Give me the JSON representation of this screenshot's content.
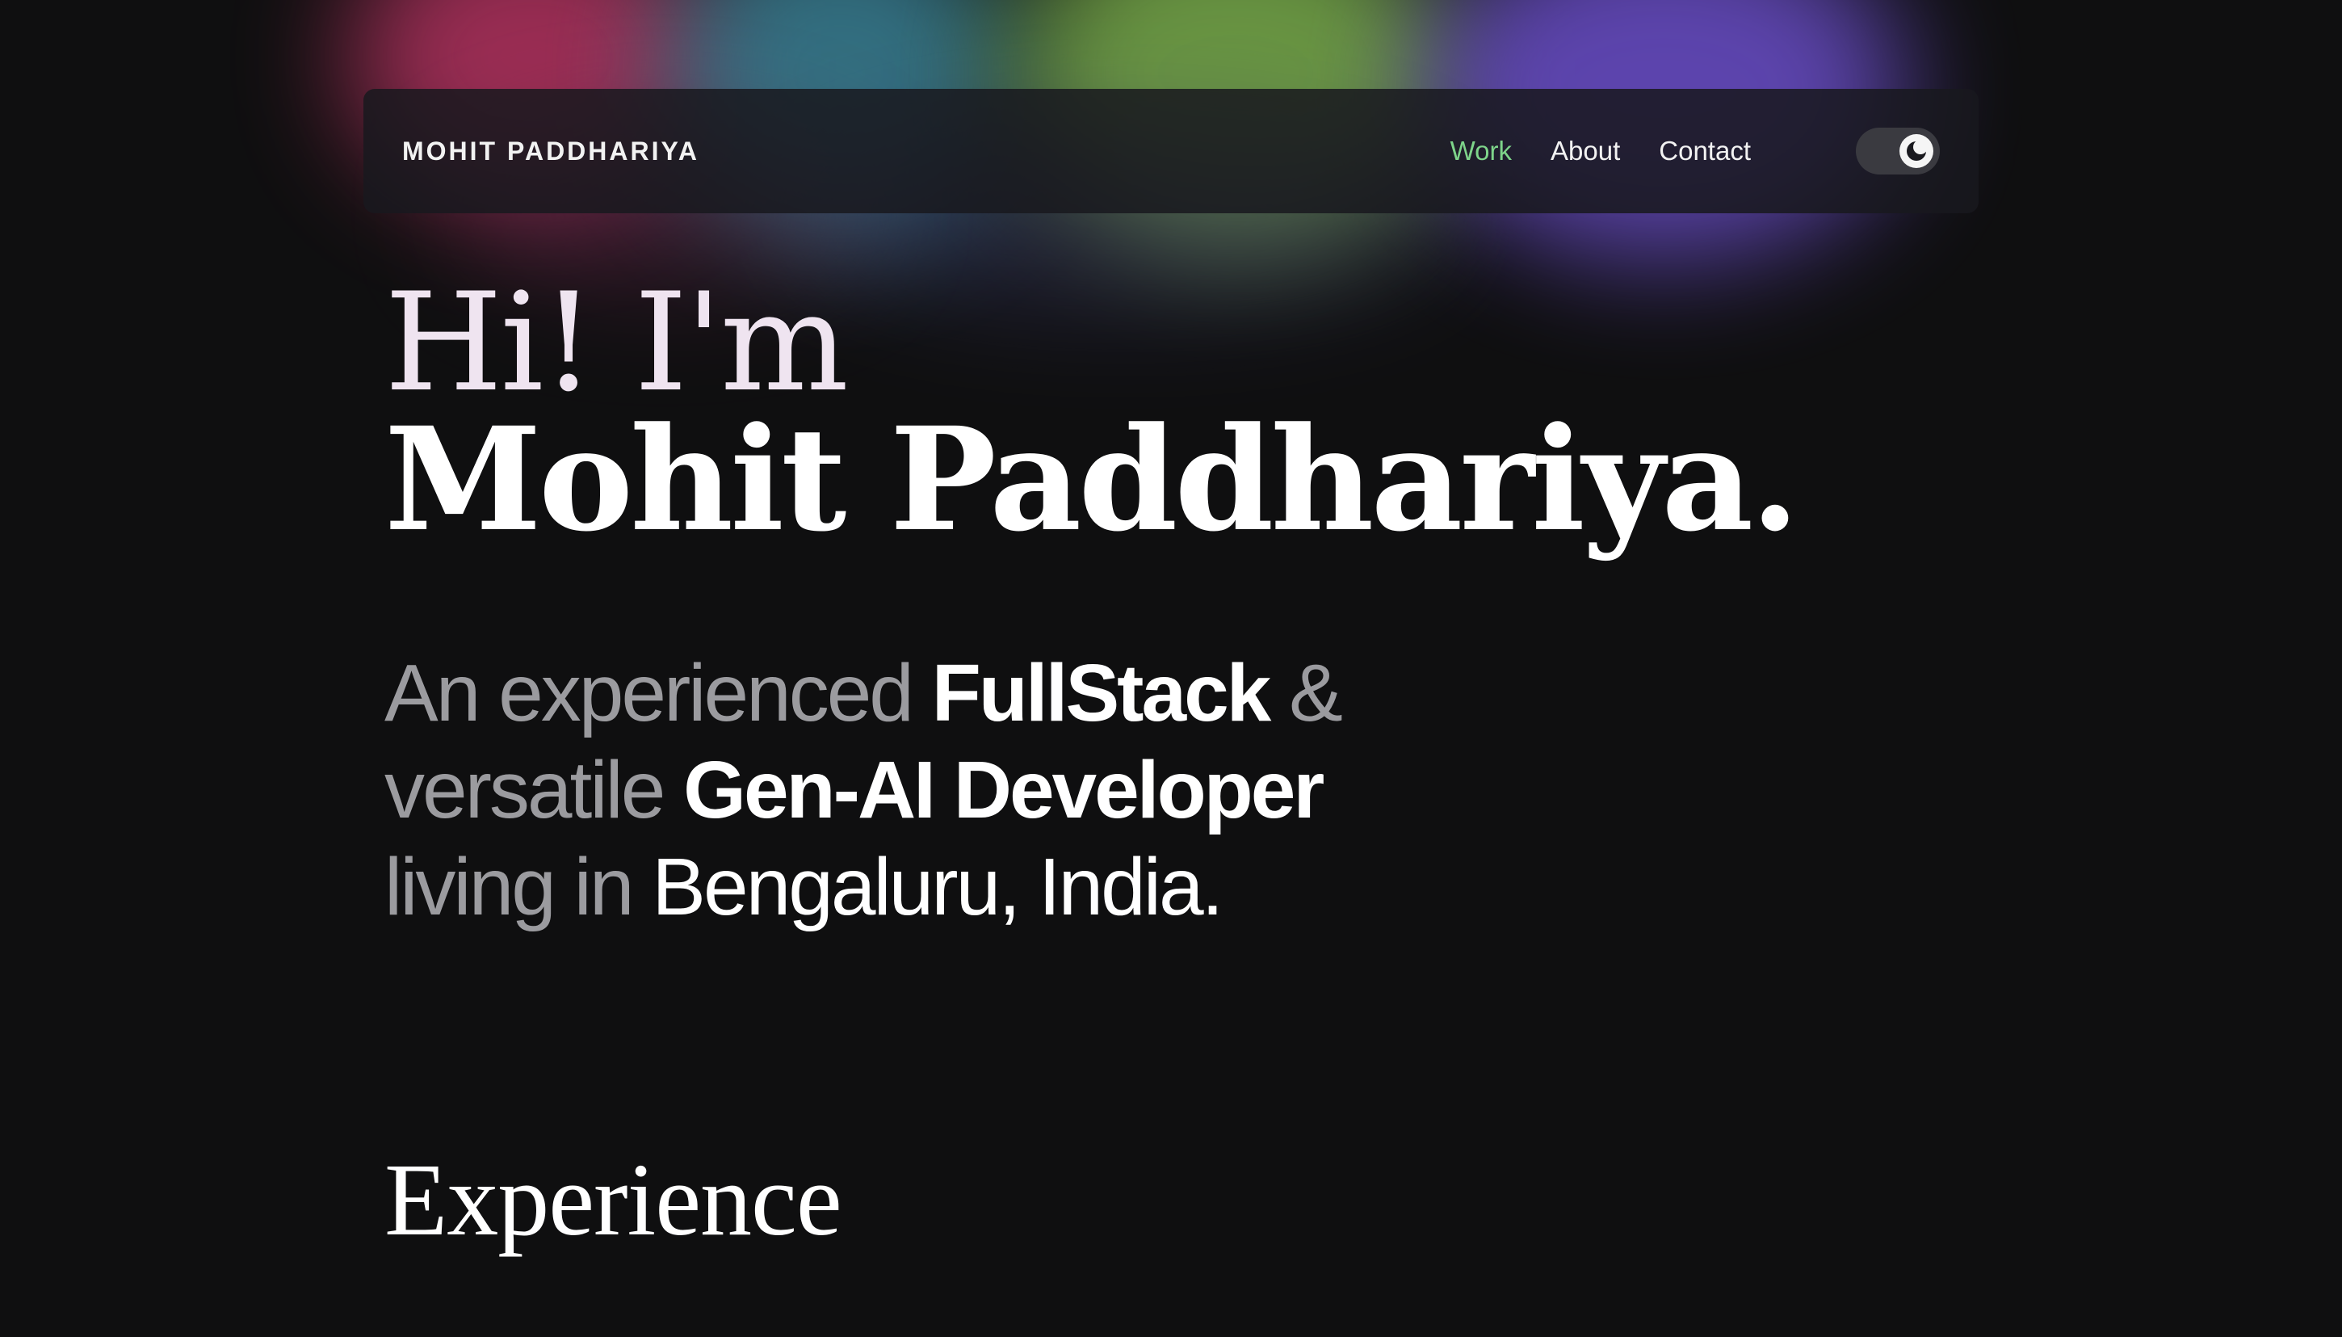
{
  "navbar": {
    "brand": "MOHIT PADDHARIYA",
    "links": [
      {
        "label": "Work",
        "active": true
      },
      {
        "label": "About",
        "active": false
      },
      {
        "label": "Contact",
        "active": false
      }
    ],
    "theme_toggle_icon": "moon-icon"
  },
  "hero": {
    "greeting": "Hi! I'm",
    "name": "Mohit Paddhariya."
  },
  "tagline": {
    "line1_muted": "An experienced ",
    "line1_highlight": "FullStack",
    "line1_muted_end": " &",
    "line2_muted": "versatile ",
    "line2_highlight": "Gen-AI Developer",
    "line3_muted": "living in ",
    "line3_highlight": "Bengaluru, India."
  },
  "sections": {
    "experience_title": "Experience"
  },
  "colors": {
    "background": "#0f0f10",
    "active_link": "#7ed48a",
    "muted_text": "#9b9b9f",
    "highlight_text": "#ffffff"
  }
}
